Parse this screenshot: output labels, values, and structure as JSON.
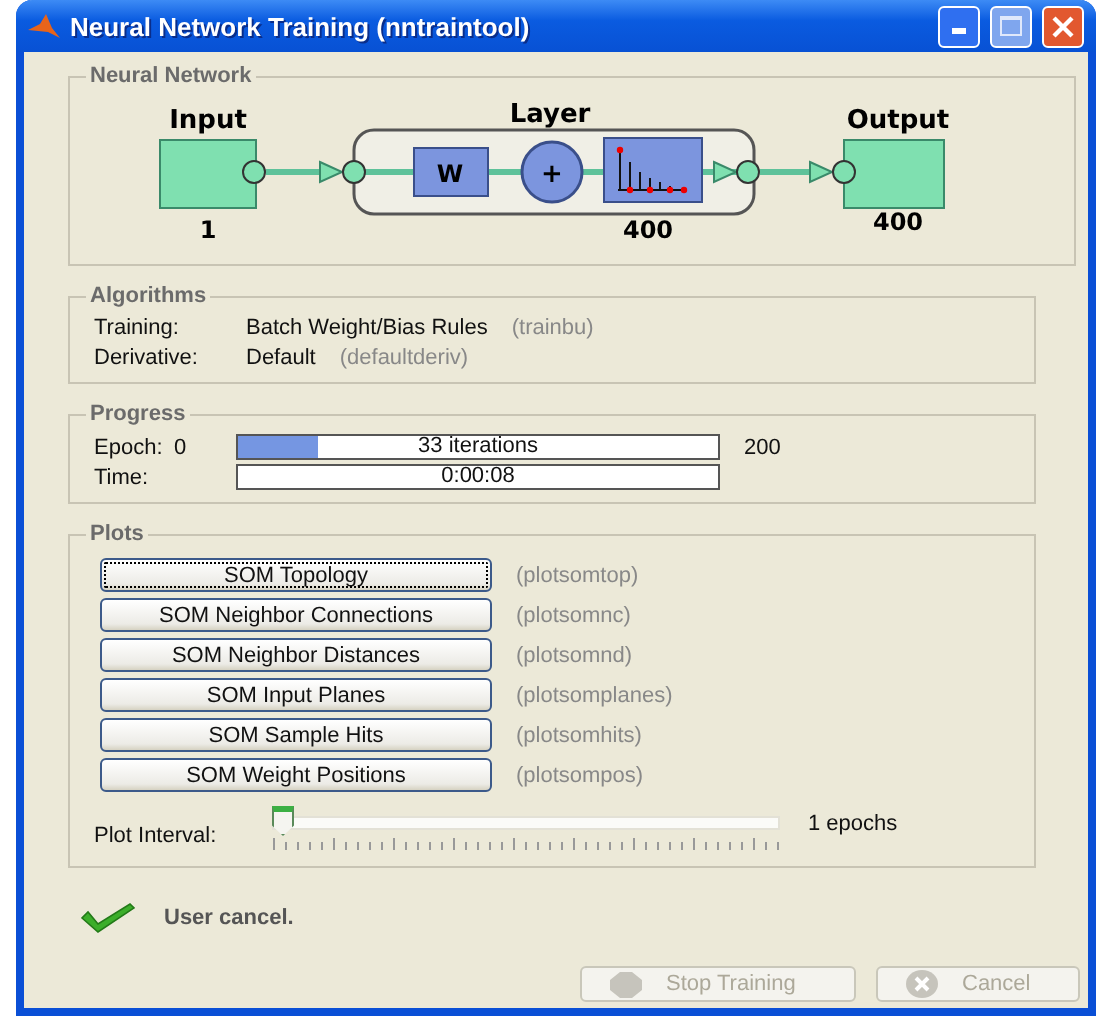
{
  "window": {
    "title": "Neural Network Training (nntraintool)"
  },
  "network": {
    "title": "Neural Network",
    "input": {
      "label": "Input",
      "size": "1"
    },
    "layer": {
      "label": "Layer",
      "weight": "W",
      "sum": "+",
      "size": "400"
    },
    "output": {
      "label": "Output",
      "size": "400"
    }
  },
  "algorithms": {
    "title": "Algorithms",
    "rows": [
      {
        "label": "Training:",
        "value": "Batch Weight/Bias Rules",
        "function": "(trainbu)"
      },
      {
        "label": "Derivative:",
        "value": "Default",
        "function": "(defaultderiv)"
      }
    ]
  },
  "progress": {
    "title": "Progress",
    "rows": [
      {
        "label": "Epoch:",
        "start": "0",
        "text": "33 iterations",
        "level": 0.165,
        "end": "200"
      },
      {
        "label": "Time:",
        "text": "0:00:08"
      }
    ]
  },
  "plots": {
    "title": "Plots",
    "items": [
      {
        "label": "SOM Topology",
        "function": "(plotsomtop)",
        "focused": true
      },
      {
        "label": "SOM Neighbor Connections",
        "function": "(plotsomnc)",
        "focused": false
      },
      {
        "label": "SOM Neighbor Distances",
        "function": "(plotsomnd)",
        "focused": false
      },
      {
        "label": "SOM Input Planes",
        "function": "(plotsomplanes)",
        "focused": false
      },
      {
        "label": "SOM Sample Hits",
        "function": "(plotsomhits)",
        "focused": false
      },
      {
        "label": "SOM Weight Positions",
        "function": "(plotsompos)",
        "focused": false
      }
    ],
    "interval": {
      "label": "Plot Interval:",
      "level": 0,
      "reading": "1 epochs"
    }
  },
  "status": {
    "text": "User cancel."
  },
  "buttons": [
    {
      "label": "Stop Training",
      "kind": "stop",
      "disabled": true
    },
    {
      "label": "Cancel",
      "kind": "cancel",
      "disabled": true
    }
  ]
}
